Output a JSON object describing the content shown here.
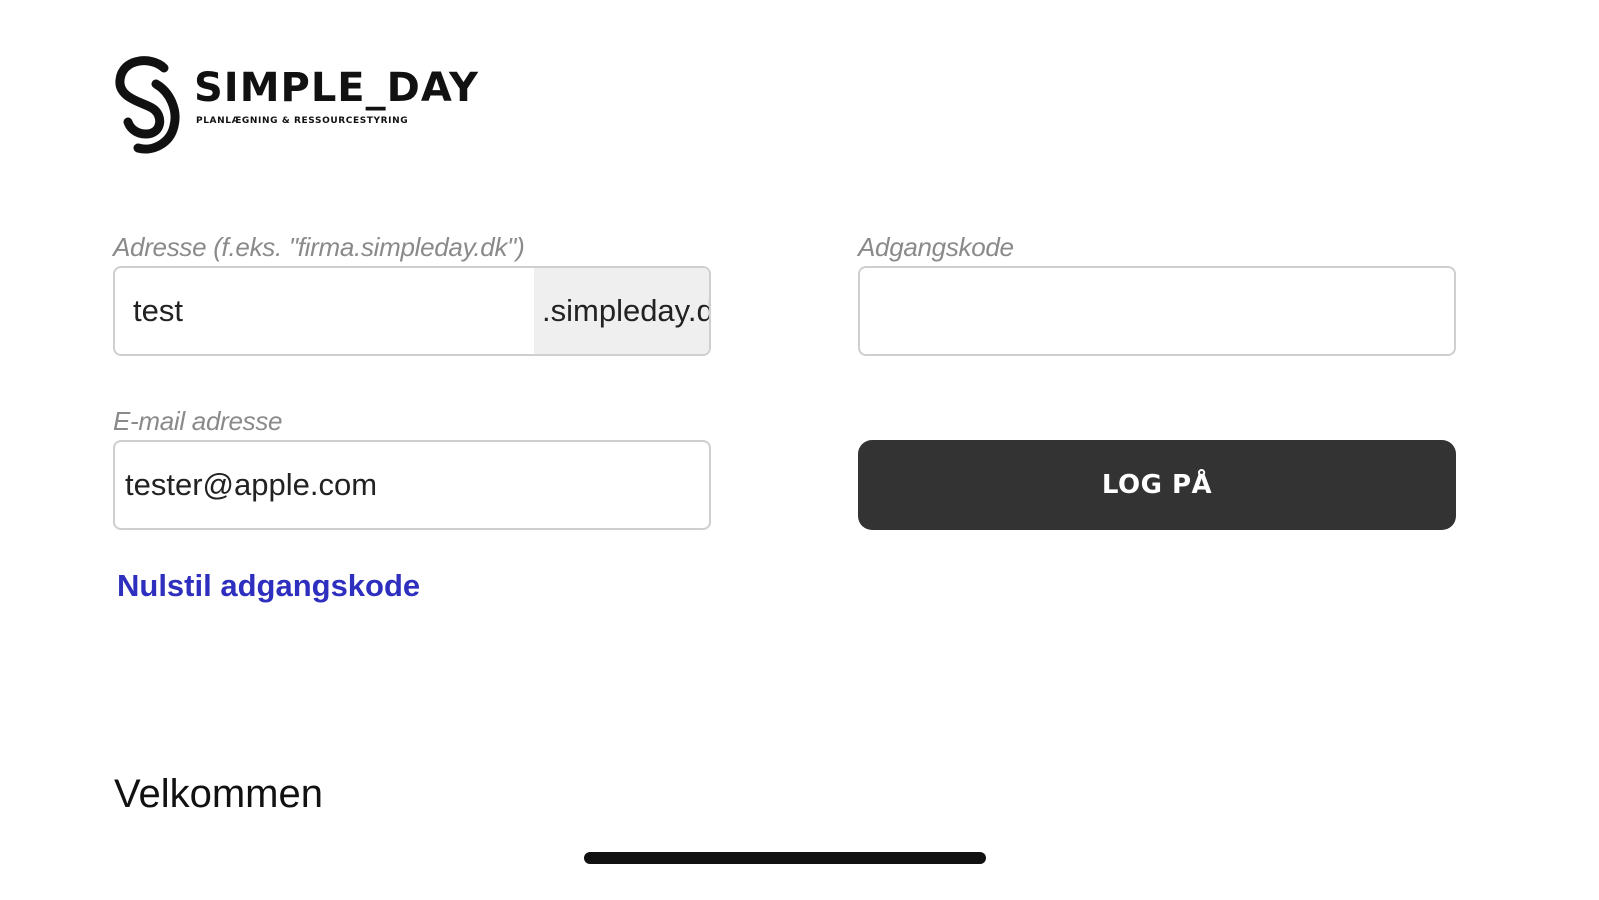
{
  "logo": {
    "name": "SIMPLE_DAY",
    "tagline": "PLANLÆGNING & RESSOURCESTYRING"
  },
  "form": {
    "address": {
      "label": "Adresse (f.eks. \"firma.simpleday.dk\")",
      "value": "test",
      "suffix": ".simpleday.dk"
    },
    "email": {
      "label": "E-mail adresse",
      "value": "tester@apple.com"
    },
    "password": {
      "label": "Adgangskode",
      "value": ""
    },
    "login_label": "LOG PÅ",
    "reset_label": "Nulstil adgangskode"
  },
  "welcome": "Velkommen",
  "colors": {
    "button_bg": "#333333",
    "link": "#2f2fbf",
    "label": "#8a8a8a",
    "suffix_bg": "#efefef"
  }
}
